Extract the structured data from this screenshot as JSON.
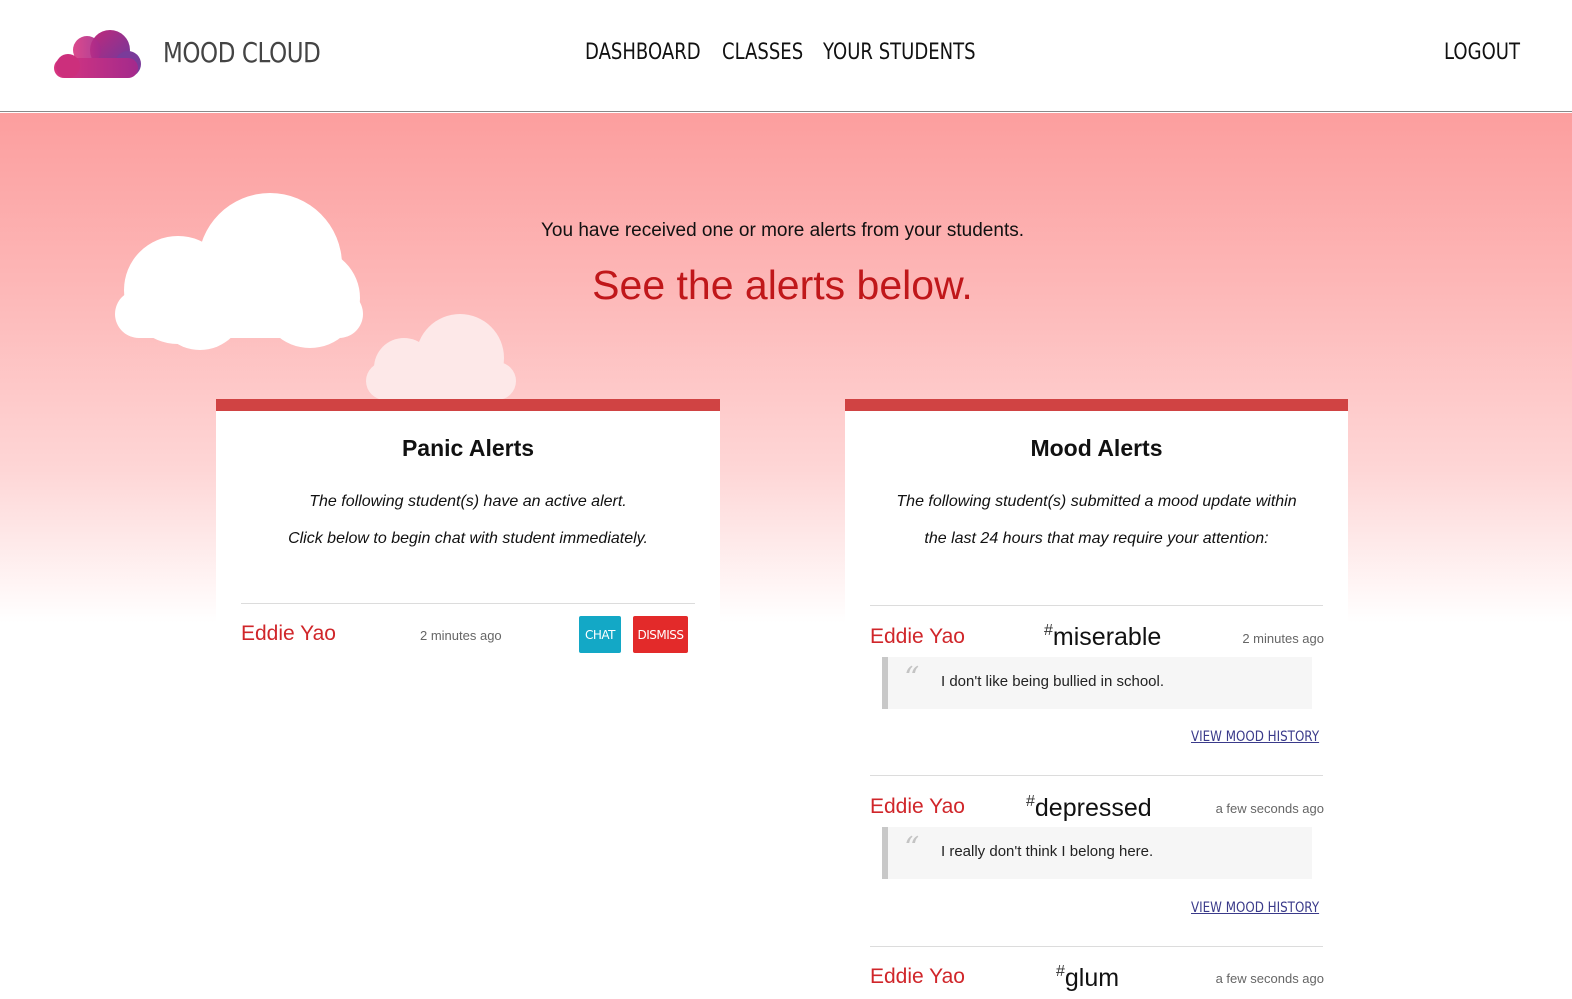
{
  "header": {
    "brand": "MOOD CLOUD",
    "nav": {
      "dashboard": "DASHBOARD",
      "classes": "CLASSES",
      "students": "YOUR STUDENTS",
      "logout": "LOGOUT"
    }
  },
  "hero": {
    "intro": "You have received one or more alerts from your students.",
    "headline": "See the alerts below."
  },
  "panic": {
    "title": "Panic Alerts",
    "desc_line1": "The following student(s) have an active alert.",
    "desc_line2": "Click below to begin chat with student immediately.",
    "alerts": [
      {
        "name": "Eddie Yao",
        "time": "2 minutes ago",
        "chat_label": "CHAT",
        "dismiss_label": "DISMISS"
      }
    ]
  },
  "mood": {
    "title": "Mood Alerts",
    "desc_line1": "The following student(s) submitted a mood update within",
    "desc_line2": "the last 24 hours that may require your attention:",
    "hash": "#",
    "history_label": "VIEW MOOD HISTORY",
    "alerts": [
      {
        "name": "Eddie Yao",
        "mood": "miserable",
        "time": "2 minutes ago",
        "comment": "I don't like being bullied in school."
      },
      {
        "name": "Eddie Yao",
        "mood": "depressed",
        "time": "a few seconds ago",
        "comment": "I really don't think I belong here."
      },
      {
        "name": "Eddie Yao",
        "mood": "glum",
        "time": "a few seconds ago"
      }
    ]
  },
  "colors": {
    "accent": "#d04343",
    "alert_red": "#c0171a",
    "chat": "#13a8c6",
    "dismiss": "#e32a2a"
  }
}
